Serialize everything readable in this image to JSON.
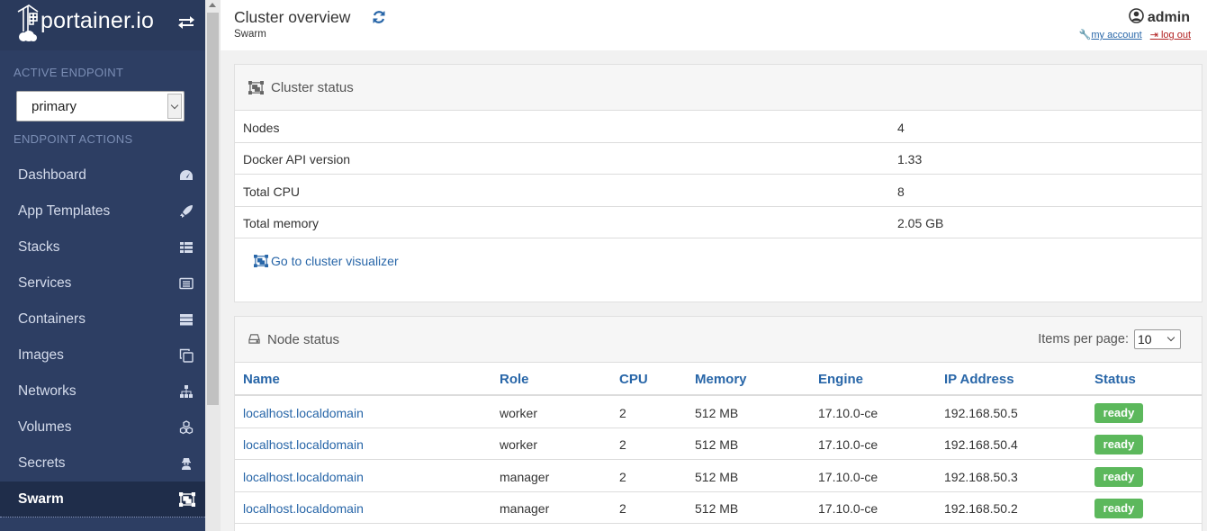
{
  "brand": {
    "logo_text": "portainer.io"
  },
  "sidebar": {
    "active_endpoint_title": "ACTIVE ENDPOINT",
    "endpoint_selected": "primary",
    "endpoint_actions_title": "ENDPOINT ACTIONS",
    "items": [
      {
        "label": "Dashboard",
        "icon": "tachometer-icon"
      },
      {
        "label": "App Templates",
        "icon": "rocket-icon"
      },
      {
        "label": "Stacks",
        "icon": "th-list-icon"
      },
      {
        "label": "Services",
        "icon": "list-alt-icon"
      },
      {
        "label": "Containers",
        "icon": "server-icon"
      },
      {
        "label": "Images",
        "icon": "clone-icon"
      },
      {
        "label": "Networks",
        "icon": "sitemap-icon"
      },
      {
        "label": "Volumes",
        "icon": "cubes-icon"
      },
      {
        "label": "Secrets",
        "icon": "user-secret-icon"
      },
      {
        "label": "Swarm",
        "icon": "object-group-icon",
        "active": true
      }
    ]
  },
  "header": {
    "title": "Cluster overview",
    "breadcrumb": "Swarm",
    "user": "admin",
    "my_account": "my account",
    "log_out": "log out"
  },
  "cluster_status": {
    "title": "Cluster status",
    "rows": [
      {
        "key": "Nodes",
        "value": "4"
      },
      {
        "key": "Docker API version",
        "value": "1.33"
      },
      {
        "key": "Total CPU",
        "value": "8"
      },
      {
        "key": "Total memory",
        "value": "2.05 GB"
      }
    ],
    "visualizer_link": "Go to cluster visualizer"
  },
  "node_status": {
    "title": "Node status",
    "items_per_page_label": "Items per page:",
    "items_per_page_value": "10",
    "columns": [
      "Name",
      "Role",
      "CPU",
      "Memory",
      "Engine",
      "IP Address",
      "Status"
    ],
    "rows": [
      {
        "name": "localhost.localdomain",
        "role": "worker",
        "cpu": "2",
        "memory": "512 MB",
        "engine": "17.10.0-ce",
        "ip": "192.168.50.5",
        "status": "ready"
      },
      {
        "name": "localhost.localdomain",
        "role": "worker",
        "cpu": "2",
        "memory": "512 MB",
        "engine": "17.10.0-ce",
        "ip": "192.168.50.4",
        "status": "ready"
      },
      {
        "name": "localhost.localdomain",
        "role": "manager",
        "cpu": "2",
        "memory": "512 MB",
        "engine": "17.10.0-ce",
        "ip": "192.168.50.3",
        "status": "ready"
      },
      {
        "name": "localhost.localdomain",
        "role": "manager",
        "cpu": "2",
        "memory": "512 MB",
        "engine": "17.10.0-ce",
        "ip": "192.168.50.2",
        "status": "ready"
      }
    ]
  },
  "colors": {
    "sidebar_bg": "#2d3e63",
    "link": "#2866a8",
    "ready_badge": "#5cb85c",
    "logout": "#b22222"
  }
}
